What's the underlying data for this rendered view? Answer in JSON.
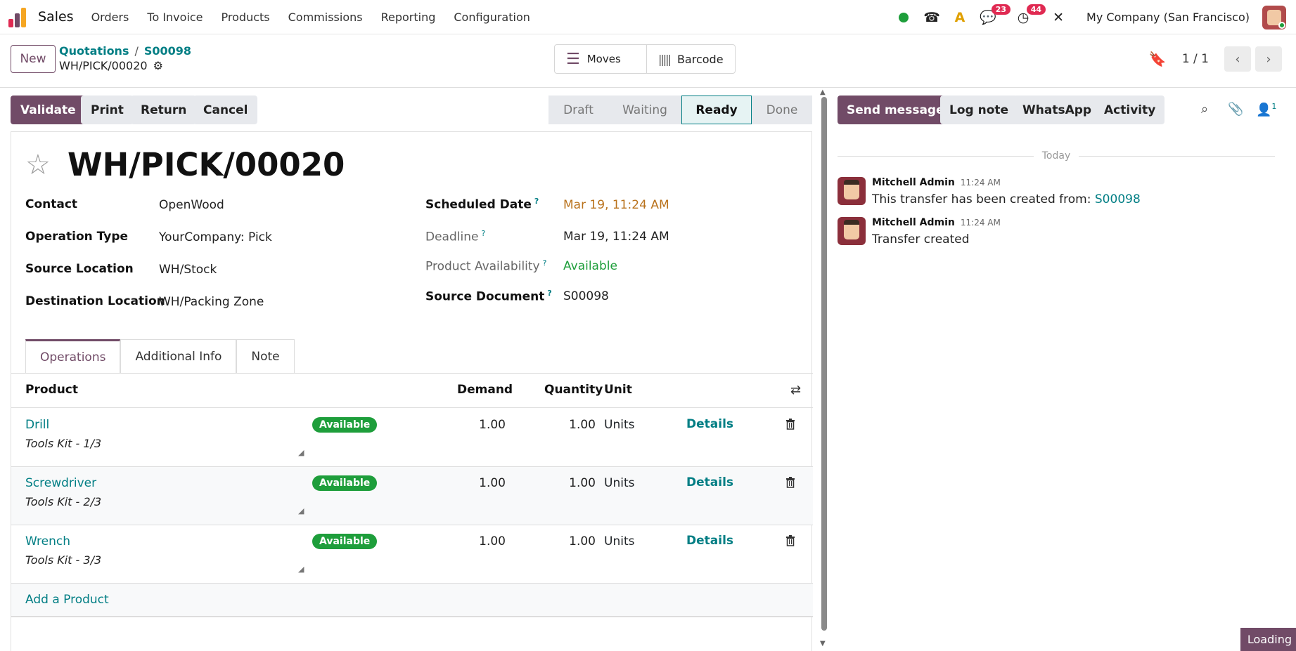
{
  "app": {
    "name": "Sales"
  },
  "menu": [
    "Orders",
    "To Invoice",
    "Products",
    "Commissions",
    "Reporting",
    "Configuration"
  ],
  "systray": {
    "messages_count": "23",
    "activities_count": "44",
    "company": "My Company (San Francisco)"
  },
  "control": {
    "new_label": "New",
    "breadcrumb": [
      "Quotations",
      "S00098"
    ],
    "record_name": "WH/PICK/00020",
    "smart_buttons": [
      "Moves",
      "Barcode"
    ],
    "pager": "1 / 1"
  },
  "actions": {
    "validate": "Validate",
    "print": "Print",
    "return": "Return",
    "cancel": "Cancel"
  },
  "stages": [
    "Draft",
    "Waiting",
    "Ready",
    "Done"
  ],
  "active_stage": "Ready",
  "form": {
    "title": "WH/PICK/00020",
    "contact_label": "Contact",
    "contact": "OpenWood",
    "operation_type_label": "Operation Type",
    "operation_type": "YourCompany: Pick",
    "source_location_label": "Source Location",
    "source_location": "WH/Stock",
    "destination_label": "Destination Location",
    "destination": "WH/Packing Zone",
    "scheduled_date_label": "Scheduled Date",
    "scheduled_date": "Mar 19, 11:24 AM",
    "deadline_label": "Deadline",
    "deadline": "Mar 19, 11:24 AM",
    "availability_label": "Product Availability",
    "availability": "Available",
    "source_document_label": "Source Document",
    "source_document": "S00098",
    "help_mark": "?"
  },
  "tabs": [
    "Operations",
    "Additional Info",
    "Note"
  ],
  "table": {
    "headers": {
      "product": "Product",
      "demand": "Demand",
      "quantity": "Quantity",
      "unit": "Unit"
    },
    "rows": [
      {
        "product": "Drill",
        "description": "Tools Kit - 1/3",
        "status": "Available",
        "demand": "1.00",
        "quantity": "1.00",
        "unit": "Units",
        "details": "Details"
      },
      {
        "product": "Screwdriver",
        "description": "Tools Kit - 2/3",
        "status": "Available",
        "demand": "1.00",
        "quantity": "1.00",
        "unit": "Units",
        "details": "Details"
      },
      {
        "product": "Wrench",
        "description": "Tools Kit - 3/3",
        "status": "Available",
        "demand": "1.00",
        "quantity": "1.00",
        "unit": "Units",
        "details": "Details"
      }
    ],
    "add_product": "Add a Product"
  },
  "chatter": {
    "send_message": "Send message",
    "log_note": "Log note",
    "whatsapp": "WhatsApp",
    "activity": "Activity",
    "followers_count": "1",
    "date_separator": "Today",
    "messages": [
      {
        "author": "Mitchell Admin",
        "time": "11:24 AM",
        "text": "This transfer has been created from:",
        "link": "S00098"
      },
      {
        "author": "Mitchell Admin",
        "time": "11:24 AM",
        "text": "Transfer created"
      }
    ]
  },
  "loading": "Loading",
  "colors": {
    "brand": "#714b67",
    "link": "#017e84",
    "success": "#1e9e3b",
    "warning": "#b9721c",
    "badge": "#e02a52"
  }
}
